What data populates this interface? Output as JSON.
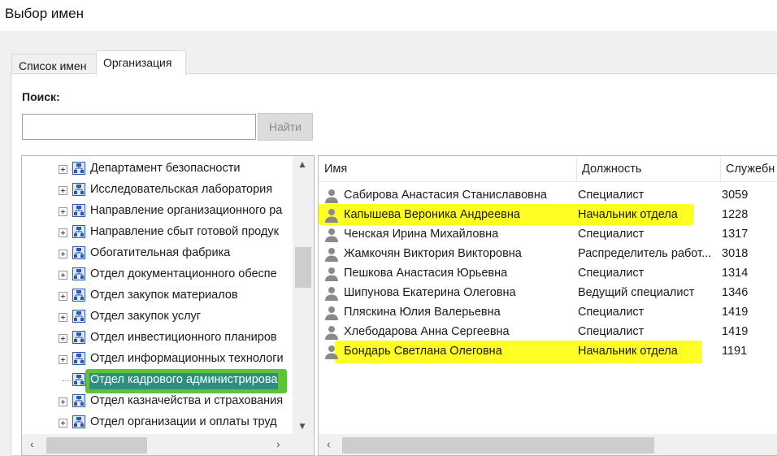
{
  "window": {
    "title": "Выбор имен"
  },
  "tabs": [
    {
      "label": "Список имен",
      "active": false
    },
    {
      "label": "Организация",
      "active": true
    }
  ],
  "search": {
    "label": "Поиск:",
    "value": "",
    "button": "Найти"
  },
  "tree": {
    "items": [
      {
        "label": "Департамент безопасности",
        "expandable": true,
        "selected": false
      },
      {
        "label": "Исследовательская лаборатория",
        "expandable": true,
        "selected": false
      },
      {
        "label": "Направление организационного ра",
        "expandable": true,
        "selected": false
      },
      {
        "label": "Направление сбыт готовой продук",
        "expandable": true,
        "selected": false
      },
      {
        "label": "Обогатительная фабрика",
        "expandable": true,
        "selected": false
      },
      {
        "label": "Отдел документационного обеспе",
        "expandable": true,
        "selected": false
      },
      {
        "label": "Отдел закупок материалов",
        "expandable": true,
        "selected": false
      },
      {
        "label": "Отдел закупок услуг",
        "expandable": true,
        "selected": false
      },
      {
        "label": "Отдел инвестиционного планиров",
        "expandable": true,
        "selected": false
      },
      {
        "label": "Отдел информационных технологи",
        "expandable": true,
        "selected": false
      },
      {
        "label": "Отдел кадрового администрирова",
        "expandable": false,
        "selected": true
      },
      {
        "label": "Отдел казначейства и страхования",
        "expandable": true,
        "selected": false
      },
      {
        "label": "Отдел организации и оплаты труд",
        "expandable": true,
        "selected": false
      }
    ]
  },
  "list": {
    "columns": [
      "Имя",
      "Должность",
      "Служебн"
    ],
    "rows": [
      {
        "name": "Сабирова Анастасия Станиславовна",
        "position": "Специалист",
        "number": "3059"
      },
      {
        "name": "Капышева Вероника Андреевна",
        "position": "Начальник отдела",
        "number": "1228"
      },
      {
        "name": "Ченская Ирина Михайловна",
        "position": "Специалист",
        "number": "1317"
      },
      {
        "name": "Жамкочян Виктория Викторовна",
        "position": "Распределитель работ...",
        "number": "3018"
      },
      {
        "name": "Пешкова Анастасия Юрьевна",
        "position": "Специалист",
        "number": "1314"
      },
      {
        "name": "Шипунова Екатерина Олеговна",
        "position": "Ведущий специалист",
        "number": "1346"
      },
      {
        "name": "Пляскина Юлия Валерьевна",
        "position": "Специалист",
        "number": "1419"
      },
      {
        "name": "Хлебодарова Анна Сергеевна",
        "position": "Специалист",
        "number": "1419"
      },
      {
        "name": "Бондарь Светлана Олеговна",
        "position": "Начальник отдела",
        "number": "1191"
      }
    ]
  },
  "colors": {
    "highlight_yellow": "#ffff00",
    "highlight_green": "#50be28",
    "selection_blue": "#0a64b4"
  }
}
